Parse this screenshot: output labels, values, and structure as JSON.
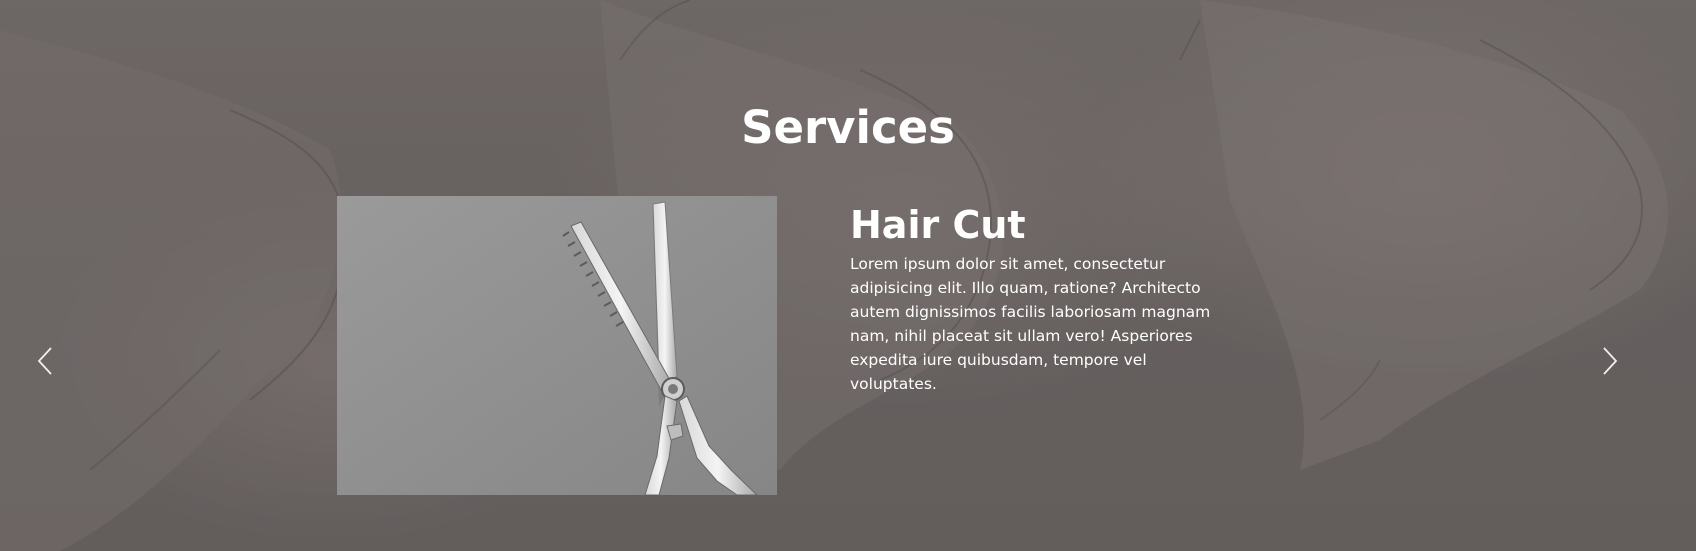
{
  "section": {
    "title": "Services"
  },
  "slide": {
    "image_alt": "thinning scissors",
    "heading": "Hair Cut",
    "description": "Lorem ipsum dolor sit amet, consectetur adipisicing elit. Illo quam, ratione? Architecto autem dignissimos facilis laboriosam magnam nam, nihil placeat sit ullam vero! Asperiores expedita iure quibusdam, tempore vel voluptates."
  },
  "carousel": {
    "prev_icon": "chevron-left-icon",
    "next_icon": "chevron-right-icon"
  },
  "colors": {
    "text": "#ffffff",
    "background": "#716968"
  }
}
